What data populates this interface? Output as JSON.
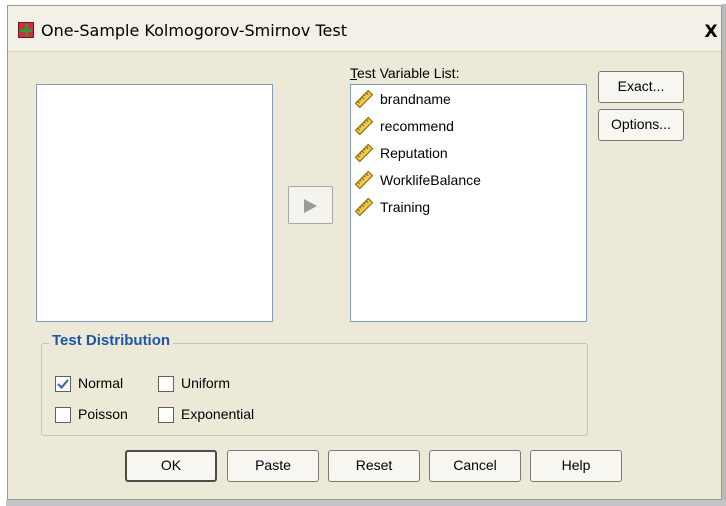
{
  "window": {
    "title": "One-Sample Kolmogorov-Smirnov Test",
    "close_label": "X"
  },
  "target_list": {
    "label": "Test Variable List:",
    "items": [
      {
        "name": "brandname",
        "icon": "ruler-scale-icon"
      },
      {
        "name": "recommend",
        "icon": "ruler-scale-icon"
      },
      {
        "name": "Reputation",
        "icon": "ruler-scale-icon"
      },
      {
        "name": "WorklifeBalance",
        "icon": "ruler-scale-icon"
      },
      {
        "name": "Training",
        "icon": "ruler-scale-icon"
      }
    ]
  },
  "source_list": {
    "items": []
  },
  "side_buttons": {
    "exact": "Exact...",
    "options": "Options..."
  },
  "test_distribution": {
    "title": "Test Distribution",
    "options": [
      {
        "label": "Normal",
        "checked": true
      },
      {
        "label": "Uniform",
        "checked": false
      },
      {
        "label": "Poisson",
        "checked": false
      },
      {
        "label": "Exponential",
        "checked": false
      }
    ]
  },
  "bottom_buttons": {
    "ok": "OK",
    "paste": "Paste",
    "reset": "Reset",
    "cancel": "Cancel",
    "help": "Help"
  },
  "colors": {
    "dialog_bg": "#ece9d8",
    "group_title": "#1f55a5",
    "check": "#3a6ea5"
  }
}
